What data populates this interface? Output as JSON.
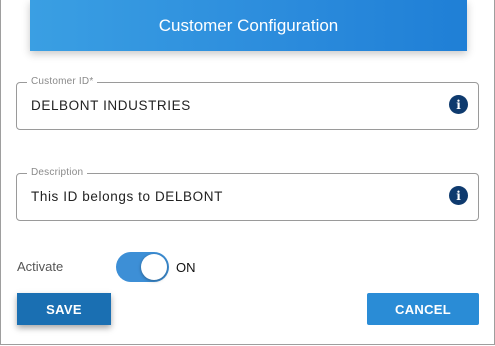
{
  "header": {
    "title": "Customer Configuration"
  },
  "fields": [
    {
      "label": "Customer ID*",
      "value": "DELBONT INDUSTRIES",
      "icon": "info-icon"
    },
    {
      "label": "Description",
      "value": "This ID belongs to DELBONT",
      "icon": "info-icon"
    }
  ],
  "activate": {
    "label": "Activate",
    "state_label": "ON",
    "on": true,
    "color": "#3d8fd6"
  },
  "buttons": {
    "save": "SAVE",
    "cancel": "CANCEL"
  },
  "colors": {
    "header": "#2b8bdc",
    "save": "#1a6fb2",
    "cancel": "#2a8cd6",
    "info_icon": "#0e3a6e"
  }
}
